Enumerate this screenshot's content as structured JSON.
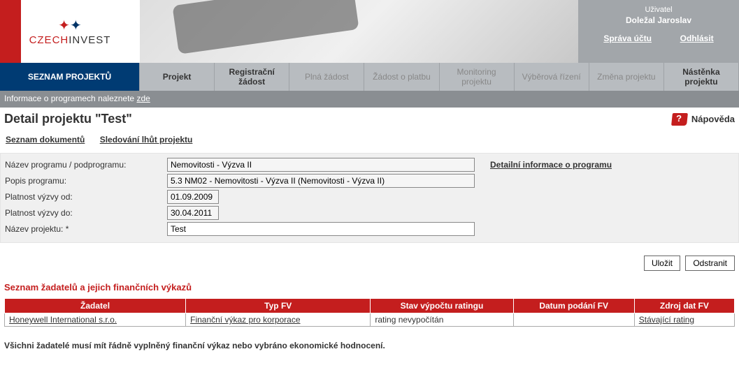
{
  "logo": {
    "brand1": "CZECH",
    "brand2": "INVEST"
  },
  "user": {
    "label": "Uživatel",
    "name": "Doležal Jaroslav",
    "account_link": "Správa účtu",
    "logout_link": "Odhlásit"
  },
  "nav": {
    "items": [
      {
        "label": "SEZNAM PROJEKTŮ",
        "active": true
      },
      {
        "label": "Projekt",
        "bold": true
      },
      {
        "label": "Registrační žádost",
        "bold": true
      },
      {
        "label": "Plná žádost",
        "grey": true
      },
      {
        "label": "Žádost o platbu",
        "grey": true
      },
      {
        "label": "Monitoring projektu",
        "grey": true
      },
      {
        "label": "Výběrová řízení",
        "grey": true
      },
      {
        "label": "Změna projektu",
        "grey": true
      },
      {
        "label": "Nástěnka projektu",
        "bold": true
      }
    ]
  },
  "infobar": {
    "text": "Informace o programech naleznete ",
    "link": "zde"
  },
  "title": "Detail projektu   \"Test\"",
  "help_label": "Nápověda",
  "tabs": {
    "doc_list": "Seznam dokumentů",
    "deadlines": "Sledování lhůt projektu"
  },
  "form": {
    "program_name_label": "Název programu / podprogramu:",
    "program_name_value": "Nemovitosti - Výzva II",
    "program_desc_label": "Popis programu:",
    "program_desc_value": "5.3 NM02 - Nemovitosti - Výzva II (Nemovitosti - Výzva II)",
    "valid_from_label": "Platnost výzvy od:",
    "valid_from_value": "01.09.2009",
    "valid_to_label": "Platnost výzvy do:",
    "valid_to_value": "30.04.2011",
    "project_name_label": "Název projektu: *",
    "project_name_value": "Test",
    "detail_link": "Detailní informace o programu"
  },
  "buttons": {
    "save": "Uložit",
    "delete": "Odstranit"
  },
  "section_title": "Seznam žadatelů a jejich finančních výkazů",
  "table": {
    "headers": [
      "Žadatel",
      "Typ FV",
      "Stav výpočtu ratingu",
      "Datum podání FV",
      "Zdroj dat FV"
    ],
    "rows": [
      {
        "zadatel": "Honeywell International s.r.o.",
        "typ": "Finanční výkaz pro korporace",
        "stav": "rating nevypočítán",
        "datum": "",
        "zdroj": "Stávající rating"
      }
    ]
  },
  "note": "Všichni žadatelé musí mít řádně vyplněný finanční výkaz nebo vybráno ekonomické hodnocení."
}
